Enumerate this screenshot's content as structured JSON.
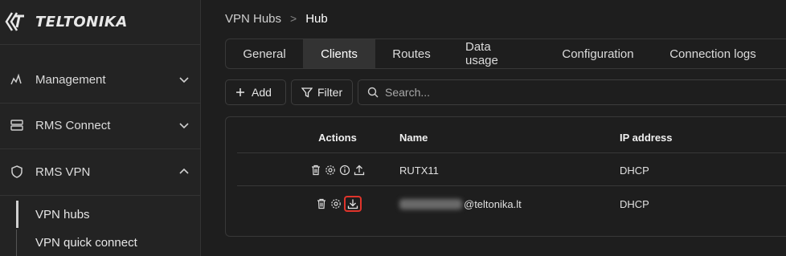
{
  "brand": {
    "logo_text": "TELTONIKA"
  },
  "sidebar": {
    "items": [
      {
        "label": "Management",
        "icon": "management-icon",
        "expanded": false
      },
      {
        "label": "RMS Connect",
        "icon": "server-icon",
        "expanded": false
      },
      {
        "label": "RMS VPN",
        "icon": "shield-icon",
        "expanded": true
      }
    ],
    "sub_items": [
      {
        "label": "VPN hubs",
        "active": true
      },
      {
        "label": "VPN quick connect",
        "active": false
      }
    ]
  },
  "breadcrumb": {
    "parent": "VPN Hubs",
    "separator": ">",
    "current": "Hub"
  },
  "tabs": [
    {
      "label": "General",
      "active": false
    },
    {
      "label": "Clients",
      "active": true
    },
    {
      "label": "Routes",
      "active": false
    },
    {
      "label": "Data usage",
      "active": false
    },
    {
      "label": "Configuration",
      "active": false
    },
    {
      "label": "Connection logs",
      "active": false
    }
  ],
  "toolbar": {
    "add_label": "Add",
    "filter_label": "Filter",
    "search_placeholder": "Search..."
  },
  "table": {
    "columns": [
      "Actions",
      "Name",
      "IP address"
    ],
    "rows": [
      {
        "name": "RUTX11",
        "ip": "DHCP",
        "actions": [
          "trash-icon",
          "gear-icon",
          "info-icon",
          "upload-icon"
        ]
      },
      {
        "name_suffix": "@teltonika.lt",
        "name_redacted": true,
        "ip": "DHCP",
        "actions": [
          "trash-icon",
          "gear-icon",
          "download-icon"
        ],
        "highlighted_action": "download-icon"
      }
    ]
  },
  "colors": {
    "background": "#1e1e1e",
    "sidebar": "#232323",
    "active_tab": "#333333",
    "highlight": "#e0342b"
  }
}
